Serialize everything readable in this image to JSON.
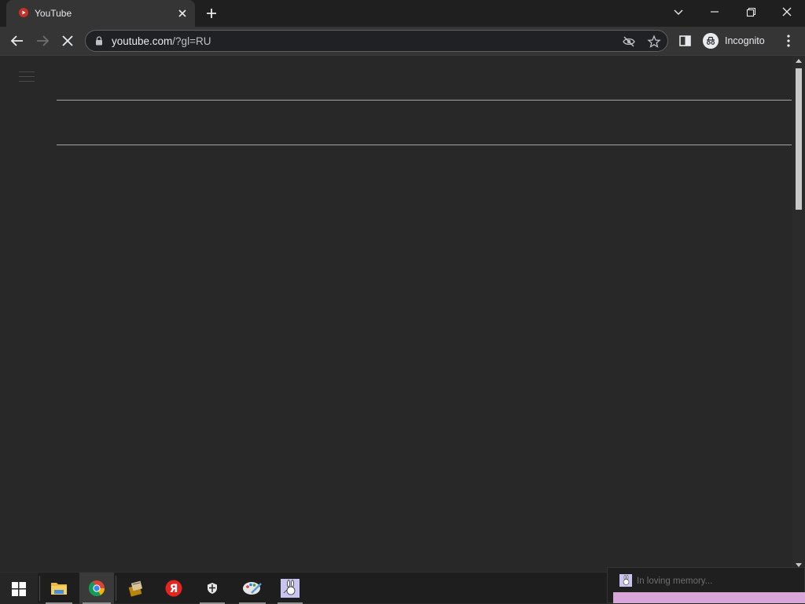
{
  "browser": {
    "tab": {
      "title": "YouTube",
      "favicon": "youtube-icon"
    },
    "new_tab_icon": "plus-icon",
    "window_controls": [
      "tab-search-icon",
      "minimize-icon",
      "restore-icon",
      "close-icon"
    ],
    "address_bar": {
      "host": "youtube.com",
      "path": "/?gl=RU",
      "lock_icon": "lock-icon"
    },
    "nav": [
      "back-icon",
      "forward-icon",
      "stop-loading-icon"
    ],
    "omnibox_icons": [
      "eye-off-icon",
      "star-icon"
    ],
    "profile": {
      "label": "Incognito",
      "icon": "incognito-icon"
    },
    "accent": "#282828"
  },
  "page": {
    "menu_icon": "hamburger-menu-icon"
  },
  "taskbar": {
    "items": [
      "windows-start-icon",
      "file-explorer-icon",
      "chrome-icon",
      "archive-app-icon",
      "yandex-browser-icon",
      "security-shield-icon",
      "paint-app-icon",
      "rabbit-app-icon"
    ]
  },
  "notification": {
    "text": "In loving memory...",
    "bar_color": "#d8a6d8"
  }
}
